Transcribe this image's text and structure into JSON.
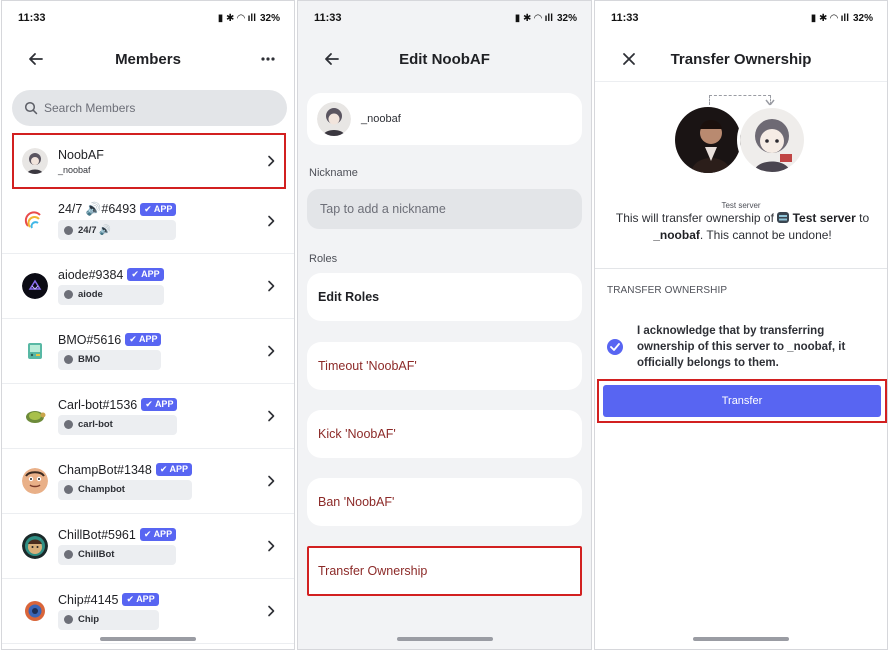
{
  "status_bar": {
    "time": "11:33",
    "battery": "32%"
  },
  "members_screen": {
    "title": "Members",
    "search_placeholder": "Search Members",
    "app_badge": "APP",
    "members": [
      {
        "name": "NoobAF",
        "sub": "_noobaf",
        "is_app": false
      },
      {
        "name": "24/7 🔊#6493",
        "is_app": true,
        "role": "24/7 🔊"
      },
      {
        "name": "aiode#9384",
        "is_app": true,
        "role": "aiode"
      },
      {
        "name": "BMO#5616",
        "is_app": true,
        "role": "BMO"
      },
      {
        "name": "Carl-bot#1536",
        "is_app": true,
        "role": "carl-bot"
      },
      {
        "name": "ChampBot#1348",
        "is_app": true,
        "role": "Champbot"
      },
      {
        "name": "ChillBot#5961",
        "is_app": true,
        "role": "ChillBot"
      },
      {
        "name": "Chip#4145",
        "is_app": true,
        "role": "Chip"
      }
    ]
  },
  "edit_screen": {
    "title": "Edit NoobAF",
    "username": "_noobaf",
    "nickname_label": "Nickname",
    "nickname_placeholder": "Tap to add a nickname",
    "roles_label": "Roles",
    "actions": {
      "edit_roles": "Edit Roles",
      "timeout": "Timeout 'NoobAF'",
      "kick": "Kick 'NoobAF'",
      "ban": "Ban 'NoobAF'",
      "transfer": "Transfer Ownership"
    }
  },
  "transfer_screen": {
    "title": "Transfer Ownership",
    "server_caption": "Test server",
    "warning_prefix": "This will transfer ownership of",
    "server_name": "Test server",
    "warning_to": "to",
    "target_user": "_noobaf",
    "warning_suffix": ". This cannot be undone!",
    "section_title": "TRANSFER OWNERSHIP",
    "acknowledge_text": "I acknowledge that by transferring ownership of this server to _noobaf, it officially belongs to them.",
    "acknowledged": true,
    "button_label": "Transfer"
  },
  "colors": {
    "accent": "#5865f2",
    "danger_text": "#8c2a28",
    "highlight_box": "#d22020"
  }
}
